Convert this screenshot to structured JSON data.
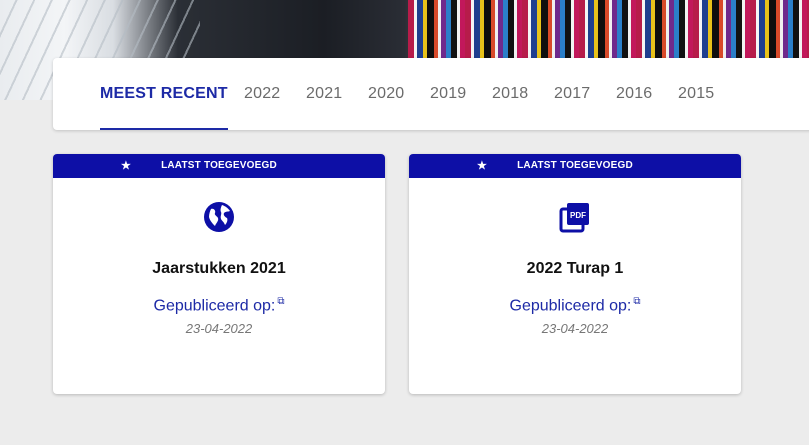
{
  "tabs": [
    {
      "label": "MEEST RECENT",
      "active": true
    },
    {
      "label": "2022"
    },
    {
      "label": "2021"
    },
    {
      "label": "2020"
    },
    {
      "label": "2019"
    },
    {
      "label": "2018"
    },
    {
      "label": "2017"
    },
    {
      "label": "2016"
    },
    {
      "label": "2015"
    }
  ],
  "cards": [
    {
      "banner": "LAATST TOEGEVOEGD",
      "icon": "globe-icon",
      "title": "Jaarstukken 2021",
      "published_label": "Gepubliceerd op:",
      "date": "23-04-2022"
    },
    {
      "banner": "LAATST TOEGEVOEGD",
      "icon": "pdf-icon",
      "icon_text": "PDF",
      "title": "2022 Turap 1",
      "published_label": "Gepubliceerd op:",
      "date": "23-04-2022"
    }
  ],
  "colors": {
    "accent": "#1d2aa6",
    "banner": "#0d0fa6",
    "background": "#ececec"
  }
}
